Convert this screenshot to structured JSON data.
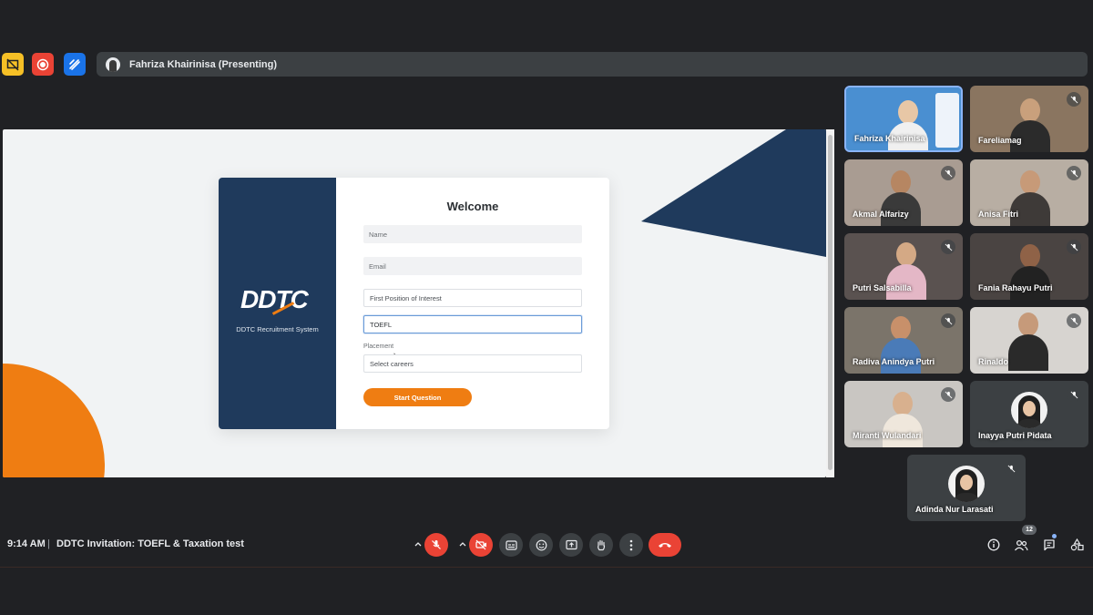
{
  "presenting": {
    "label": "Fahriza Khairinisa (Presenting)"
  },
  "shared_screen": {
    "logo_text": "DDTC",
    "system_name": "DDTC Recruitment System",
    "welcome": "Welcome",
    "fields": {
      "name_placeholder": "Name",
      "email_placeholder": "Email",
      "position_value": "First Position of Interest",
      "test_value": "TOEFL",
      "placement_label": "Placement",
      "placement_value": "Select careers"
    },
    "start_button": "Start Question",
    "colors": {
      "navy": "#1f3a5c",
      "orange": "#ef7d12"
    }
  },
  "participants": [
    {
      "name": "Fahriza Khairinisa",
      "muted": false,
      "active": true
    },
    {
      "name": "Fareliamag",
      "muted": true
    },
    {
      "name": "Akmal Alfarizy",
      "muted": true
    },
    {
      "name": "Anisa Fitri",
      "muted": true
    },
    {
      "name": "Putri Salsabilla",
      "muted": true
    },
    {
      "name": "Fania Rahayu Putri",
      "muted": true
    },
    {
      "name": "Radiva Anindya Putri",
      "muted": true
    },
    {
      "name": "Rinaldo",
      "muted": true
    },
    {
      "name": "Miranti Wulandari",
      "muted": true
    },
    {
      "name": "Inayya Putri Pidata",
      "muted": true
    },
    {
      "name": "Adinda Nur Larasati",
      "muted": true
    }
  ],
  "bottom_bar": {
    "time": "9:14 AM",
    "separator": "|",
    "meeting_title": "DDTC Invitation: TOEFL & Taxation test",
    "people_count": "12"
  },
  "icons": {
    "present": "presentation-off-icon",
    "record": "record-icon",
    "whiteboard": "whiteboard-icon",
    "mic_off": "mic-off-icon",
    "cam_off": "camera-off-icon",
    "captions": "captions-icon",
    "emoji": "emoji-icon",
    "present_now": "present-now-icon",
    "hand": "raise-hand-icon",
    "more": "more-vert-icon",
    "hangup": "hang-up-icon",
    "info": "info-icon",
    "people": "people-icon",
    "chat": "chat-icon",
    "activities": "activities-icon"
  }
}
